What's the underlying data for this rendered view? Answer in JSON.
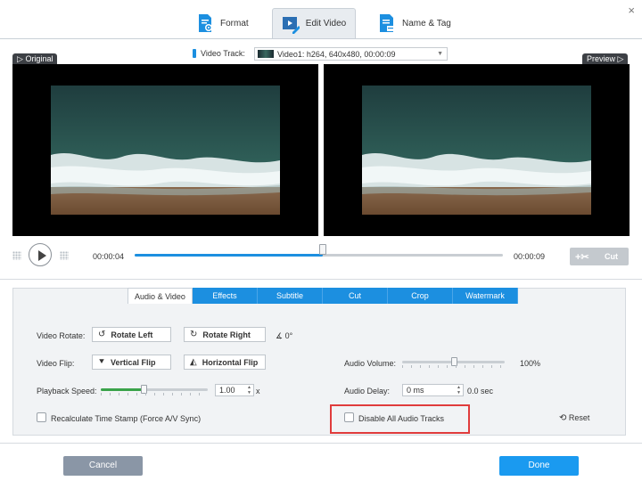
{
  "tabs": [
    {
      "label": "Format",
      "icon": "format-settings-icon"
    },
    {
      "label": "Edit Video",
      "icon": "edit-video-icon",
      "active": true
    },
    {
      "label": "Name & Tag",
      "icon": "name-tag-icon"
    }
  ],
  "video_track": {
    "label": "Video Track:",
    "value": "Video1: h264, 640x480, 00:00:09"
  },
  "panes": {
    "original_label": "Original",
    "preview_label": "Preview"
  },
  "timeline": {
    "current_time": "00:00:04",
    "end_time": "00:00:09",
    "progress": 0.51,
    "cut_label": "Cut"
  },
  "sub_tabs": [
    "Audio & Video",
    "Effects",
    "Subtitle",
    "Cut",
    "Crop",
    "Watermark"
  ],
  "settings": {
    "video_rotate_label": "Video Rotate:",
    "rotate_left": "Rotate Left",
    "rotate_right": "Rotate Right",
    "rotate_angle": "0°",
    "video_flip_label": "Video Flip:",
    "vertical_flip": "Vertical Flip",
    "horizontal_flip": "Horizontal Flip",
    "playback_speed_label": "Playback Speed:",
    "playback_speed_value": "1.00",
    "playback_speed_unit": "x",
    "playback_speed_level": 0.4,
    "audio_volume_label": "Audio Volume:",
    "audio_volume_value": "100%",
    "audio_volume_level": 0.5,
    "audio_delay_label": "Audio Delay:",
    "audio_delay_value": "0 ms",
    "audio_delay_sec": "0.0 sec",
    "recalc_label": "Recalculate Time Stamp (Force A/V Sync)",
    "disable_audio_label": "Disable All Audio Tracks",
    "reset_label": "Reset"
  },
  "footer": {
    "cancel_label": "Cancel",
    "done_label": "Done"
  },
  "colors": {
    "accent": "#1c8fe0",
    "slider_green": "#3aa34a",
    "highlight": "#e03c3c"
  }
}
